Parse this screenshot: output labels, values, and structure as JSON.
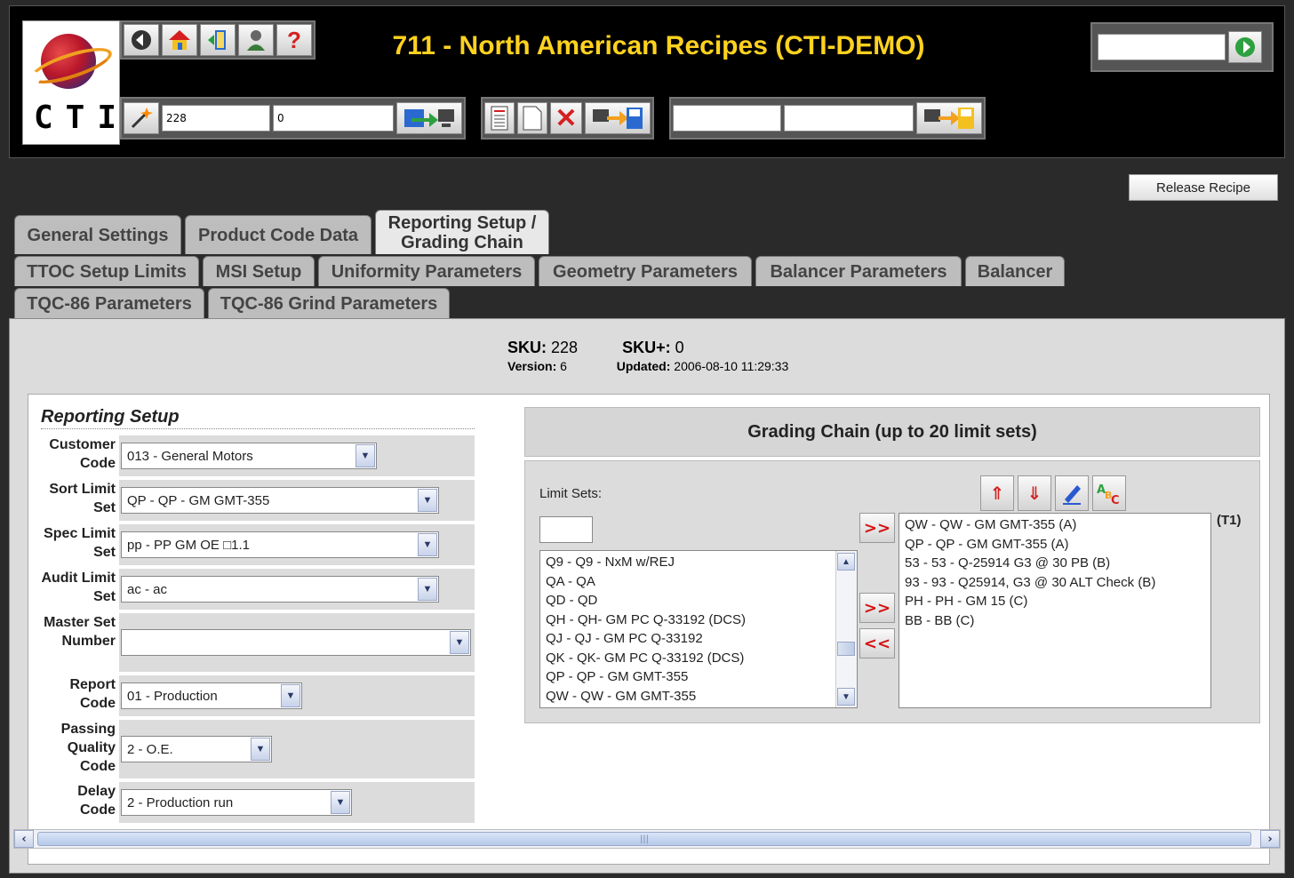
{
  "app": {
    "title": "711 - North American Recipes (CTI-DEMO)",
    "logo_text": "CTI"
  },
  "toolbar": {
    "sku_value": "228",
    "sku_plus_value": "0",
    "field3_value": "",
    "field4_value": "",
    "search_value": ""
  },
  "icons": {
    "back": "back-arrow-icon",
    "home": "home-icon",
    "exit": "exit-door-icon",
    "user": "user-icon",
    "help": "help-icon",
    "wand": "magic-wand-icon",
    "load": "load-recipe-icon",
    "list": "list-icon",
    "new": "new-document-icon",
    "delete": "delete-x-icon",
    "save": "save-icon",
    "copy": "copy-save-icon",
    "go": "go-arrow-icon"
  },
  "release_label": "Release Recipe",
  "tabs": {
    "general": "General Settings",
    "product": "Product Code Data",
    "reporting": "Reporting Setup / Grading Chain",
    "ttoc": "TTOC Setup Limits",
    "msi": "MSI Setup",
    "uniformity": "Uniformity Parameters",
    "geometry": "Geometry Parameters",
    "balancer_params": "Balancer Parameters",
    "balancer": "Balancer",
    "tqc": "TQC-86 Parameters",
    "tqc_grind": "TQC-86 Grind Parameters"
  },
  "sku_info": {
    "sku_label": "SKU:",
    "sku": "228",
    "sku_plus_label": "SKU+:",
    "sku_plus": "0",
    "version_label": "Version:",
    "version": "6",
    "updated_label": "Updated:",
    "updated": "2006-08-10 11:29:33"
  },
  "reporting": {
    "title": "Reporting Setup",
    "customer_code": {
      "label": "Customer Code",
      "value": "013 - General Motors"
    },
    "sort_limit": {
      "label": "Sort Limit Set",
      "value": "QP - QP - GM GMT-355"
    },
    "spec_limit": {
      "label": "Spec Limit Set",
      "value": "pp - PP GM OE □1.1"
    },
    "audit_limit": {
      "label": "Audit Limit Set",
      "value": "ac - ac"
    },
    "master_set": {
      "label": "Master Set Number",
      "value": ""
    },
    "report_code": {
      "label": "Report Code",
      "value": "01 - Production"
    },
    "passing_quality": {
      "label": "Passing Quality Code",
      "value": "2 - O.E."
    },
    "delay_code": {
      "label": "Delay Code",
      "value": "2 - Production run"
    }
  },
  "grading": {
    "title": "Grading Chain (up to 20 limit sets)",
    "limit_sets_label": "Limit Sets:",
    "filter_value": "",
    "tier_label": "(T1)",
    "available": [
      "Q9 - Q9 - NxM w/REJ",
      "QA - QA",
      "QD - QD",
      "QH - QH- GM PC Q-33192 (DCS)",
      "QJ - QJ - GM PC Q-33192",
      "QK - QK- GM PC Q-33192 (DCS)",
      "QP - QP - GM GMT-355",
      "QW - QW - GM GMT-355"
    ],
    "chain": [
      "QW - QW - GM GMT-355 (A)",
      "QP - QP - GM GMT-355 (A)",
      "53 - 53 - Q-25914 G3 @ 30 PB (B)",
      "93 - 93 - Q25914, G3 @ 30 ALT Check (B)",
      "PH - PH - GM 15 (C)",
      "BB - BB (C)"
    ],
    "add_label": ">>",
    "remove_label": "<<"
  }
}
